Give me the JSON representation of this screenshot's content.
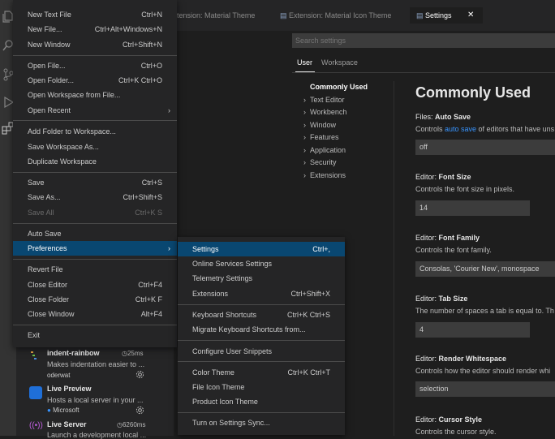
{
  "tabs": [
    {
      "label": "tension: Material Theme",
      "active": false
    },
    {
      "label": "Extension: Material Icon Theme",
      "active": false
    },
    {
      "label": "Settings",
      "active": true
    }
  ],
  "tab_close_glyph": "✕",
  "settings": {
    "search_placeholder": "Search settings",
    "scope_tabs": [
      "User",
      "Workspace"
    ],
    "toc": [
      {
        "label": "Commonly Used",
        "selected": true
      },
      {
        "label": "Text Editor"
      },
      {
        "label": "Workbench"
      },
      {
        "label": "Window"
      },
      {
        "label": "Features"
      },
      {
        "label": "Application"
      },
      {
        "label": "Security"
      },
      {
        "label": "Extensions"
      }
    ],
    "section_title": "Commonly Used",
    "items": [
      {
        "category": "Files: ",
        "name": "Auto Save",
        "desc_pre": "Controls ",
        "desc_link": "auto save",
        "desc_post": " of editors that have uns",
        "value": "off"
      },
      {
        "category": "Editor: ",
        "name": "Font Size",
        "desc": "Controls the font size in pixels.",
        "value": "14"
      },
      {
        "category": "Editor: ",
        "name": "Font Family",
        "desc": "Controls the font family.",
        "value": "Consolas, 'Courier New', monospace"
      },
      {
        "category": "Editor: ",
        "name": "Tab Size",
        "desc": "The number of spaces a tab is equal to. Th",
        "value": "4"
      },
      {
        "category": "Editor: ",
        "name": "Render Whitespace",
        "desc": "Controls how the editor should render whi",
        "value": "selection"
      },
      {
        "category": "Editor: ",
        "name": "Cursor Style",
        "desc": "Controls the cursor style."
      }
    ]
  },
  "file_menu": [
    {
      "label": "New Text File",
      "key": "Ctrl+N"
    },
    {
      "label": "New File...",
      "key": "Ctrl+Alt+Windows+N"
    },
    {
      "label": "New Window",
      "key": "Ctrl+Shift+N"
    },
    {
      "label": "Open File...",
      "key": "Ctrl+O"
    },
    {
      "label": "Open Folder...",
      "key": "Ctrl+K Ctrl+O"
    },
    {
      "label": "Open Workspace from File...",
      "key": ""
    },
    {
      "label": "Open Recent",
      "key": "",
      "arrow": "›"
    },
    {
      "label": "Add Folder to Workspace...",
      "key": ""
    },
    {
      "label": "Save Workspace As...",
      "key": ""
    },
    {
      "label": "Duplicate Workspace",
      "key": ""
    },
    {
      "label": "Save",
      "key": "Ctrl+S"
    },
    {
      "label": "Save As...",
      "key": "Ctrl+Shift+S"
    },
    {
      "label": "Save All",
      "key": "Ctrl+K S",
      "disabled": true
    },
    {
      "label": "Auto Save",
      "key": ""
    },
    {
      "label": "Preferences",
      "key": "",
      "arrow": "›",
      "highlighted": true
    },
    {
      "label": "Revert File",
      "key": ""
    },
    {
      "label": "Close Editor",
      "key": "Ctrl+F4"
    },
    {
      "label": "Close Folder",
      "key": "Ctrl+K F"
    },
    {
      "label": "Close Window",
      "key": "Alt+F4"
    },
    {
      "label": "Exit",
      "key": ""
    }
  ],
  "preferences_menu": [
    {
      "label": "Settings",
      "key": "Ctrl+,",
      "highlighted": true
    },
    {
      "label": "Online Services Settings",
      "key": ""
    },
    {
      "label": "Telemetry Settings",
      "key": ""
    },
    {
      "label": "Extensions",
      "key": "Ctrl+Shift+X"
    },
    {
      "label": "Keyboard Shortcuts",
      "key": "Ctrl+K Ctrl+S"
    },
    {
      "label": "Migrate Keyboard Shortcuts from...",
      "key": ""
    },
    {
      "label": "Configure User Snippets",
      "key": ""
    },
    {
      "label": "Color Theme",
      "key": "Ctrl+K Ctrl+T"
    },
    {
      "label": "File Icon Theme",
      "key": ""
    },
    {
      "label": "Product Icon Theme",
      "key": ""
    },
    {
      "label": "Turn on Settings Sync...",
      "key": ""
    }
  ],
  "extensions": [
    {
      "name": "indent-rainbow",
      "time": "25ms",
      "desc": "Makes indentation easier to ...",
      "publisher": "oderwat",
      "gear_icon": "gear-icon"
    },
    {
      "name": "Live Preview",
      "time": "",
      "desc": "Hosts a local server in your ...",
      "publisher": "Microsoft",
      "gear_icon": "gear-icon"
    },
    {
      "name": "Live Server",
      "time": "6260ms",
      "desc": "Launch a development local ...",
      "publisher": ""
    }
  ],
  "time_glyph": "◷",
  "colors": {
    "accent": "#094771",
    "link": "#3794ff"
  }
}
